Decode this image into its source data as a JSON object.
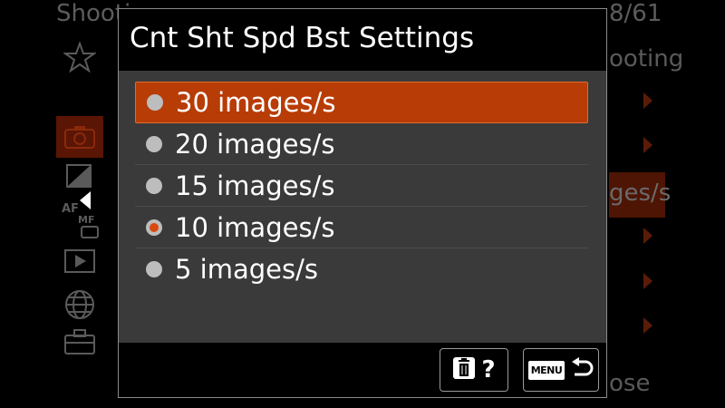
{
  "background": {
    "header_left": "Shooti",
    "header_right": "8/61",
    "right_texts": [
      "ooting",
      "ges/s",
      "ose"
    ],
    "side_icons": [
      "star-icon",
      "camera-icon",
      "exposure-icon",
      "auto-mode-icon",
      "playback-icon",
      "globe-icon",
      "toolbox-icon"
    ]
  },
  "dialog": {
    "title": "Cnt Sht Spd Bst Settings",
    "options": [
      {
        "label": "30 images/s",
        "focused": true,
        "checked": false
      },
      {
        "label": "20 images/s",
        "focused": false,
        "checked": false
      },
      {
        "label": "15 images/s",
        "focused": false,
        "checked": false
      },
      {
        "label": "10 images/s",
        "focused": false,
        "checked": true
      },
      {
        "label": "5 images/s",
        "focused": false,
        "checked": false
      }
    ],
    "footer": {
      "help_label": "?",
      "menu_label": "MENU"
    }
  },
  "colors": {
    "accent": "#b83c06",
    "radio_on": "#d94a10",
    "dialog_bg": "#3a3a3a"
  }
}
